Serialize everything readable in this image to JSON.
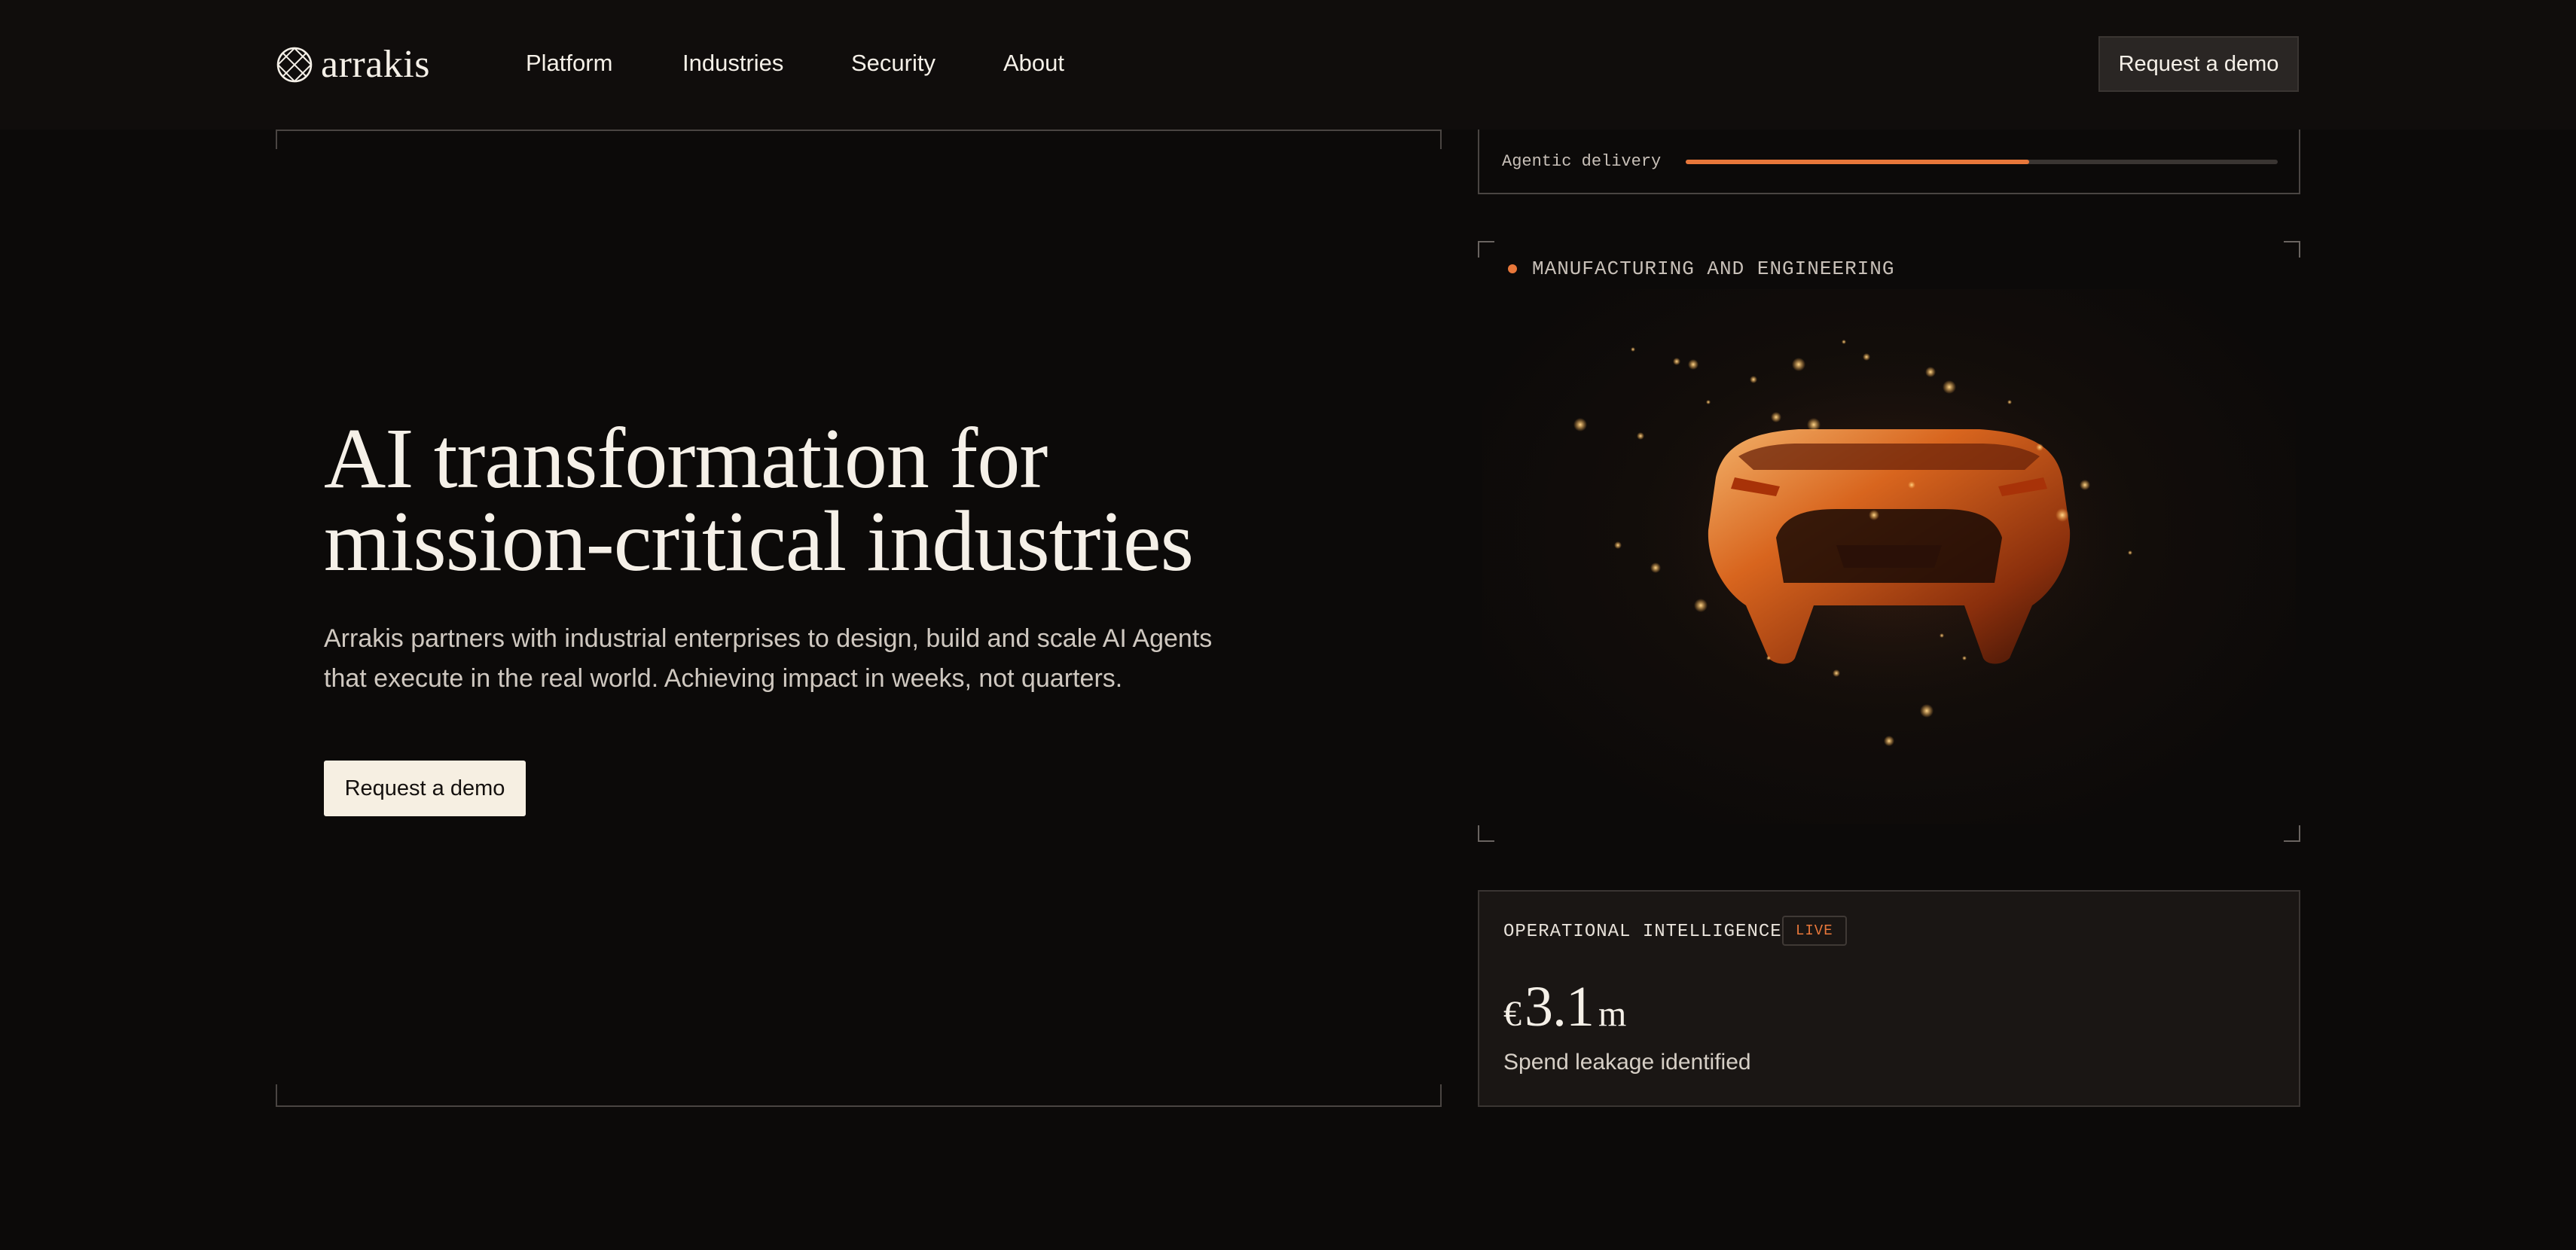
{
  "brand": {
    "name": "arrakis"
  },
  "nav": {
    "items": [
      {
        "label": "Platform"
      },
      {
        "label": "Industries"
      },
      {
        "label": "Security"
      },
      {
        "label": "About"
      }
    ],
    "cta_label": "Request a demo"
  },
  "hero": {
    "title_lines": [
      "AI transformation for",
      "mission-critical industries"
    ],
    "subtitle_lines": [
      "Arrakis partners with industrial enterprises to design, build and scale AI Agents",
      "that execute in the real world. Achieving impact in weeks, not quarters."
    ],
    "cta_label": "Request a demo"
  },
  "delivery": {
    "label": "Agentic delivery",
    "progress": 0.58
  },
  "industry": {
    "label": "MANUFACTURING AND ENGINEERING",
    "image_icon": "sports-car-rear-image"
  },
  "stat": {
    "title": "OPERATIONAL INTELLIGENCE",
    "badge": "LIVE",
    "currency": "€",
    "number": "3.1",
    "unit": "m",
    "description": "Spend leakage identified"
  },
  "colors": {
    "accent": "#e8773a",
    "background": "#0c0a09",
    "text": "#f5f0e8",
    "cta_light": "#f6efe2"
  }
}
